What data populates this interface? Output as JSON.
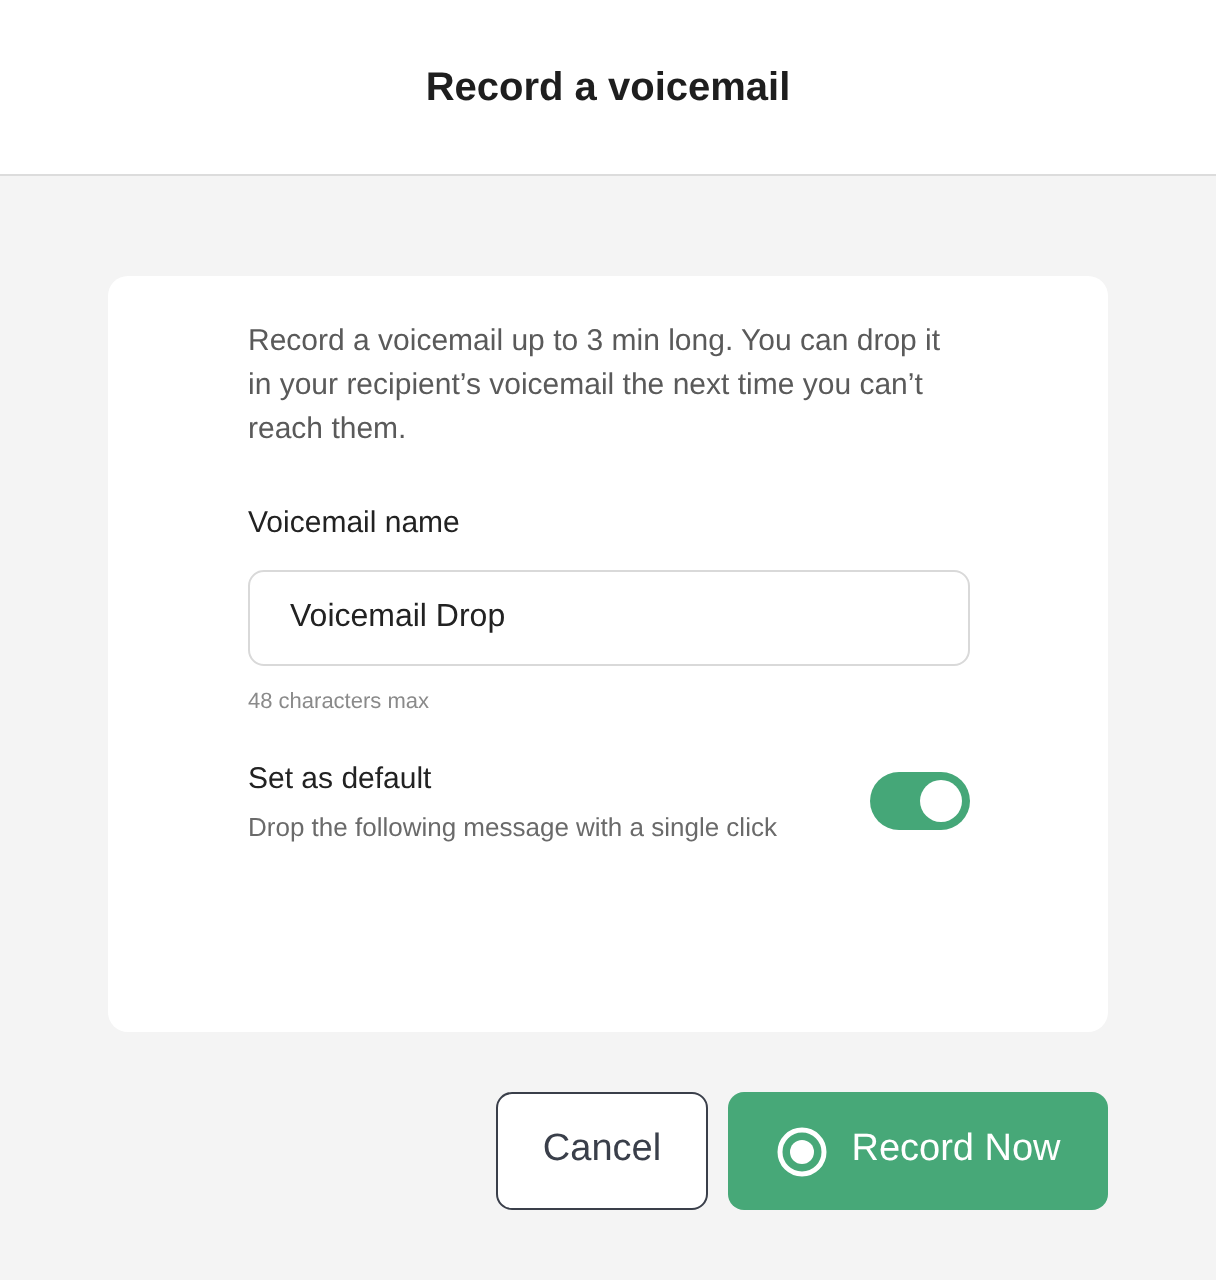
{
  "header": {
    "title": "Record a voicemail"
  },
  "card": {
    "intro": "Record a voicemail up to 3 min long. You can drop it in your recipient’s voicemail the next time you can’t reach them.",
    "name_field": {
      "label": "Voicemail name",
      "value": "Voicemail Drop",
      "hint": "48 characters max"
    },
    "default_setting": {
      "label": "Set as default",
      "description": "Drop the following message with a single click",
      "on": true
    }
  },
  "buttons": [
    {
      "label": "Cancel",
      "kind": "secondary"
    },
    {
      "label": "Record Now",
      "kind": "primary"
    }
  ]
}
